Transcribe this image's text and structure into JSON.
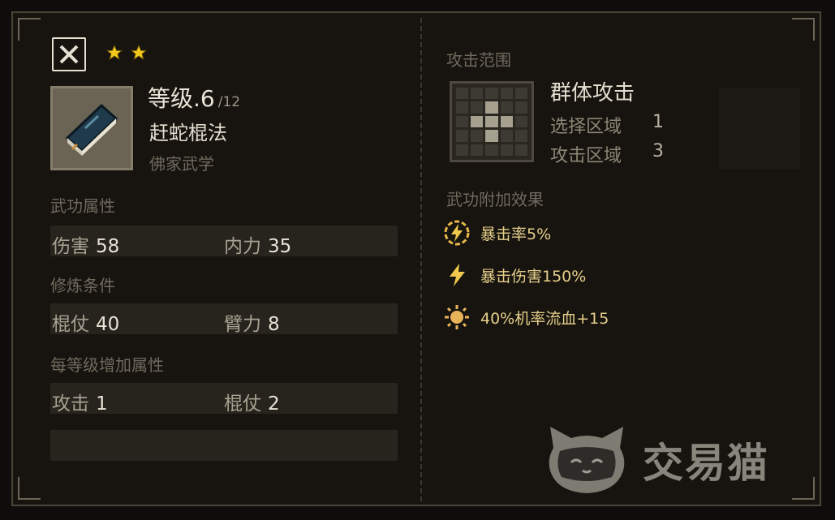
{
  "header": {
    "stars": 2
  },
  "skill": {
    "level_label": "等级.6",
    "level_max": "/12",
    "name": "赶蛇棍法",
    "school": "佛家武学"
  },
  "sections": {
    "attributes": {
      "title": "武功属性",
      "items": [
        {
          "label": "伤害",
          "value": "58"
        },
        {
          "label": "内力",
          "value": "35"
        }
      ]
    },
    "requirements": {
      "title": "修炼条件",
      "items": [
        {
          "label": "棍仗",
          "value": "40"
        },
        {
          "label": "臂力",
          "value": "8"
        }
      ]
    },
    "per_level": {
      "title": "每等级增加属性",
      "items": [
        {
          "label": "攻击",
          "value": "1"
        },
        {
          "label": "棍仗",
          "value": "2"
        }
      ]
    }
  },
  "range": {
    "title": "攻击范围",
    "type": "群体攻击",
    "select_label": "选择区域",
    "select_value": "1",
    "attack_label": "攻击区域",
    "attack_value": "3",
    "pattern": [
      [
        0,
        0,
        0,
        0,
        0
      ],
      [
        0,
        0,
        1,
        0,
        0
      ],
      [
        0,
        1,
        1,
        1,
        0
      ],
      [
        0,
        0,
        1,
        0,
        0
      ],
      [
        0,
        0,
        0,
        0,
        0
      ]
    ]
  },
  "effects": {
    "title": "武功附加效果",
    "items": [
      {
        "icon": "lightning-circle-icon",
        "text": "暴击率5%"
      },
      {
        "icon": "lightning-icon",
        "text": "暴击伤害150%"
      },
      {
        "icon": "sun-burst-icon",
        "text": "40%机率流血+15"
      }
    ]
  },
  "watermark": {
    "text": "交易猫"
  },
  "colors": {
    "accent": "#e6cf8a",
    "star": "#f2c81b",
    "panel": "#17140f"
  }
}
